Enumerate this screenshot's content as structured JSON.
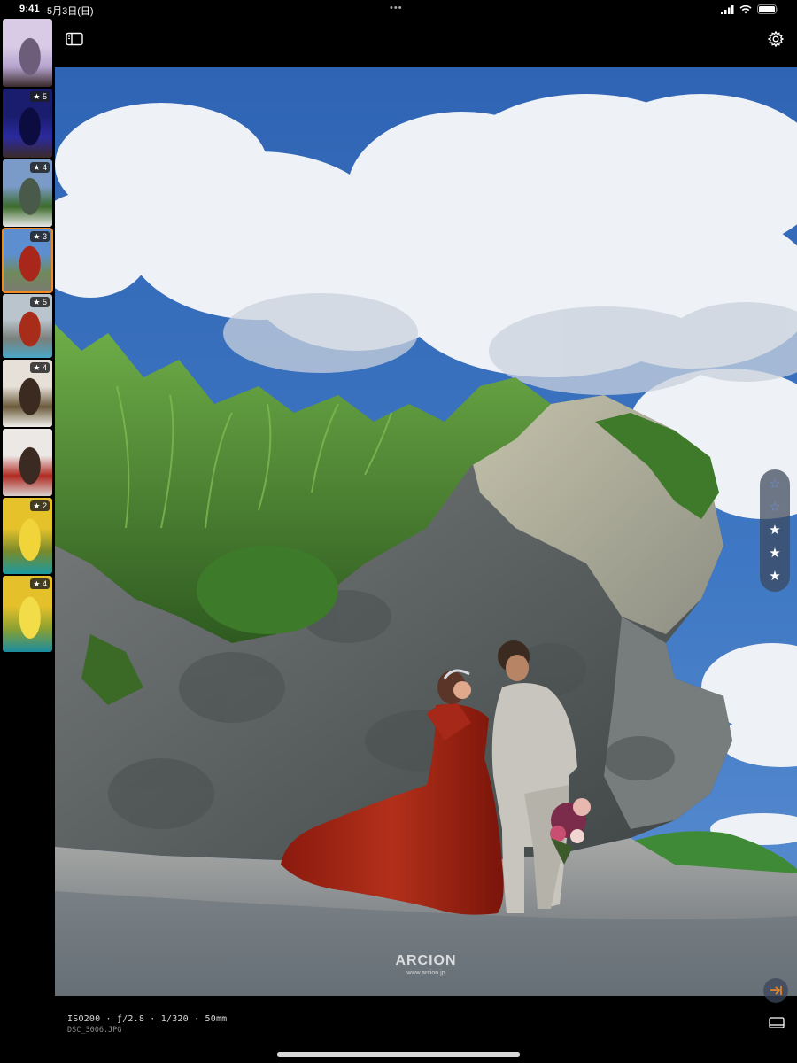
{
  "status_bar": {
    "time": "9:41",
    "date": "5月3日(日)",
    "icons": [
      "cellular-icon",
      "wifi-icon",
      "battery-icon"
    ]
  },
  "toolbar": {
    "sidebar_toggle_icon": "sidebar-icon",
    "settings_icon": "gear-icon"
  },
  "thumbnails": [
    {
      "rating": ""
    },
    {
      "rating": "★ 5"
    },
    {
      "rating": "★ 4"
    },
    {
      "rating": "★ 3",
      "selected": true
    },
    {
      "rating": "★ 5"
    },
    {
      "rating": "★ 4"
    },
    {
      "rating": ""
    },
    {
      "rating": "★ 2"
    },
    {
      "rating": "★ 4"
    }
  ],
  "photo": {
    "watermark_brand": "ARCION",
    "watermark_url": "www.arcion.jp"
  },
  "rating_panel": {
    "stars": [
      "☆",
      "☆",
      "★",
      "★",
      "★"
    ],
    "value": 3,
    "max": 5,
    "accent": "#6e8fd8"
  },
  "info": {
    "exif": "ISO200 · ƒ/2.8 · 1/320 · 50mm",
    "filename": "DSC_3006.JPG"
  },
  "colors": {
    "selection": "#f08a24",
    "background": "#000000"
  }
}
